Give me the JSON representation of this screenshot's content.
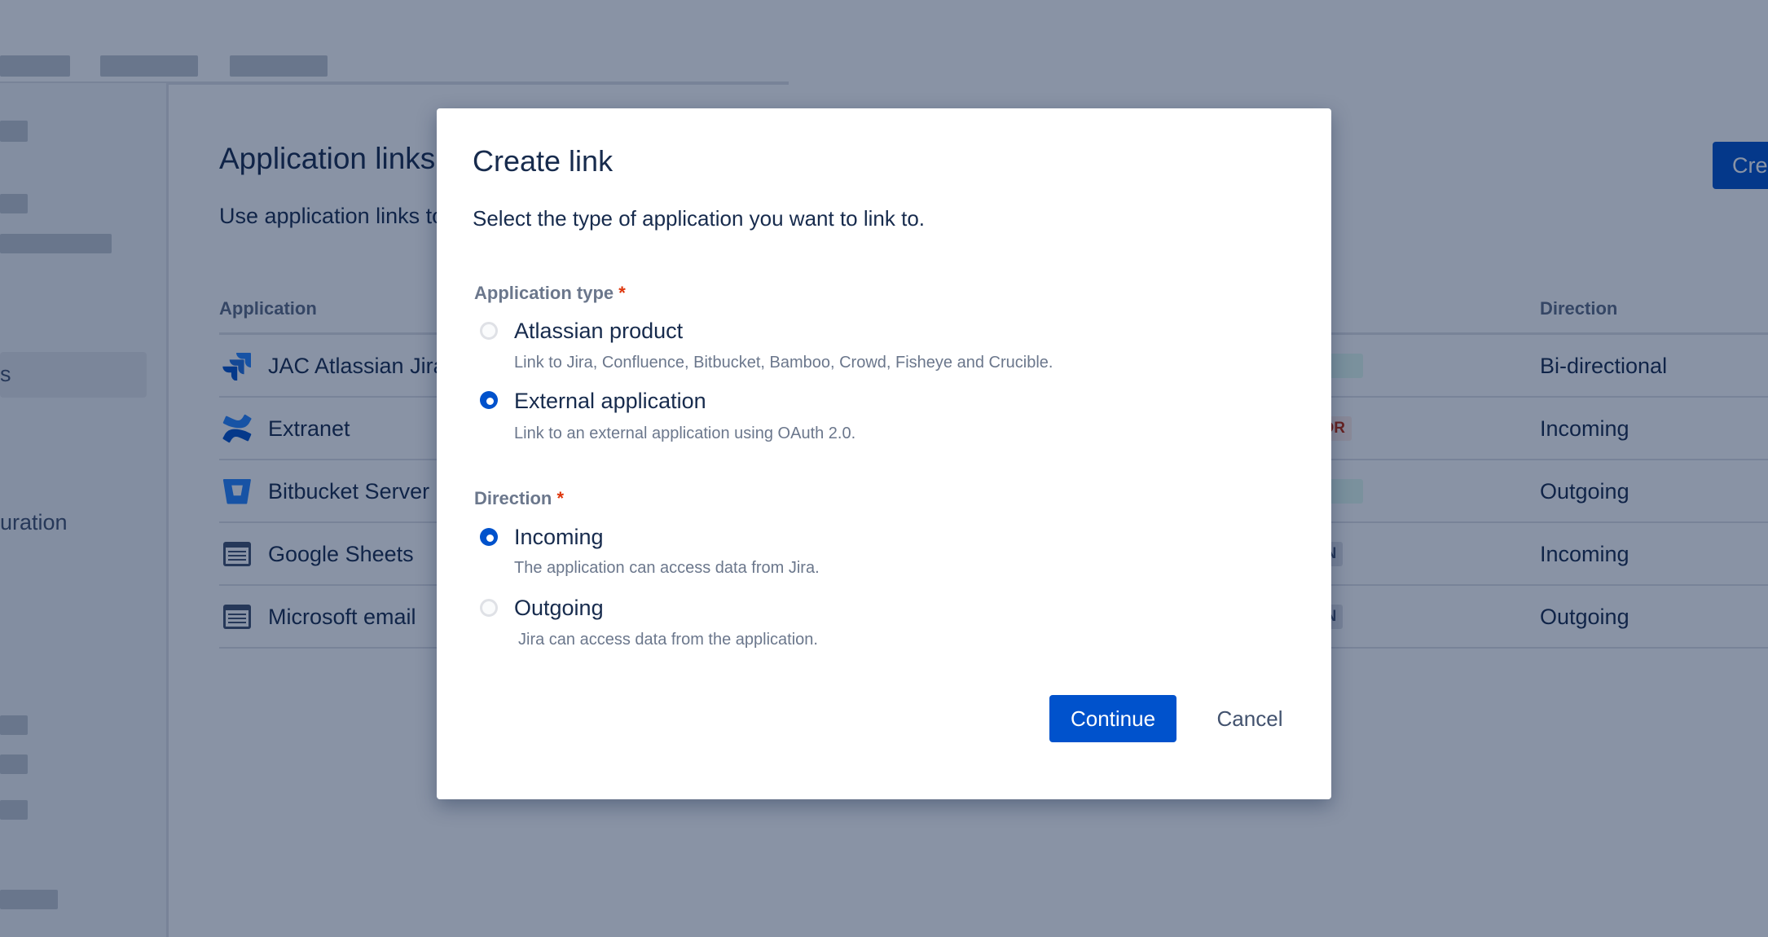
{
  "page": {
    "title": "Application links",
    "description": "Use application links to",
    "create_button": "Cre",
    "sidebar_selected_text": "s",
    "sidebar_text": "uration"
  },
  "table": {
    "columns": [
      "Application",
      "Direction"
    ],
    "rows": [
      {
        "name": "JAC Atlassian Jira",
        "icon": "jira-icon",
        "badge": "",
        "direction": "Bi-directional"
      },
      {
        "name": "Extranet",
        "icon": "confluence-icon",
        "badge": "RROR",
        "direction": "Incoming"
      },
      {
        "name": "Bitbucket Server",
        "icon": "bitbucket-icon",
        "badge": "",
        "direction": "Outgoing"
      },
      {
        "name": "Google Sheets",
        "icon": "generic-app-icon",
        "badge": "SIAN",
        "direction": "Incoming"
      },
      {
        "name": "Microsoft email",
        "icon": "generic-app-icon",
        "badge": "SIAN",
        "direction": "Outgoing"
      }
    ]
  },
  "modal": {
    "title": "Create link",
    "subtitle": "Select the type of application you want to link to.",
    "application_type": {
      "label": "Application type",
      "required_mark": "*",
      "options": [
        {
          "label": "Atlassian product",
          "description": "Link to Jira, Confluence, Bitbucket, Bamboo, Crowd, Fisheye and Crucible.",
          "checked": false
        },
        {
          "label": "External application",
          "description": "Link to an external application using OAuth 2.0.",
          "checked": true
        }
      ]
    },
    "direction": {
      "label": "Direction",
      "required_mark": "*",
      "options": [
        {
          "label": "Incoming",
          "description": "The application can access data from Jira.",
          "checked": true
        },
        {
          "label": "Outgoing",
          "description": "Jira can access data from the application.",
          "checked": false
        }
      ]
    },
    "continue_button": "Continue",
    "cancel_button": "Cancel"
  },
  "colors": {
    "primary": "#0052cc",
    "overlay": "#091e42",
    "required": "#de350b"
  }
}
